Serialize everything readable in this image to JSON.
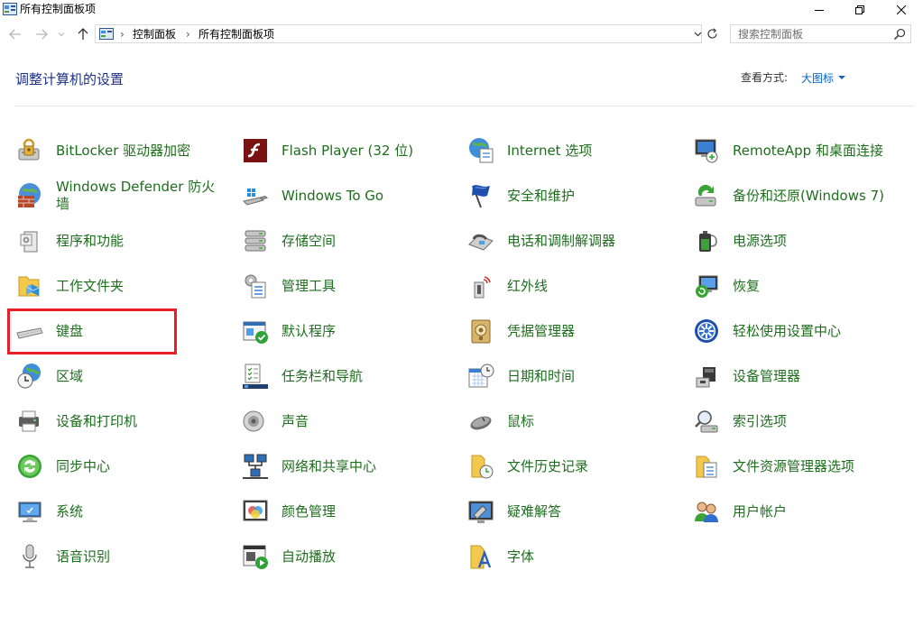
{
  "window": {
    "title": "所有控制面板项"
  },
  "address": {
    "crumbs": [
      "控制面板",
      "所有控制面板项"
    ]
  },
  "search": {
    "placeholder": "搜索控制面板"
  },
  "header": {
    "heading": "调整计算机的设置",
    "viewby_label": "查看方式:",
    "viewby_value": "大图标"
  },
  "accent": {
    "link_green": "#1e6e1e",
    "heading_blue": "#1e3287",
    "highlight_red": "#e81f27"
  },
  "columns": [
    [
      {
        "label": "BitLocker 驱动器加密",
        "icon": "bitlocker-icon"
      },
      {
        "label": "Windows Defender 防火墙",
        "icon": "firewall-icon"
      },
      {
        "label": "程序和功能",
        "icon": "programs-icon"
      },
      {
        "label": "工作文件夹",
        "icon": "work-folders-icon"
      },
      {
        "label": "键盘",
        "icon": "keyboard-icon"
      },
      {
        "label": "区域",
        "icon": "region-icon"
      },
      {
        "label": "设备和打印机",
        "icon": "printer-icon"
      },
      {
        "label": "同步中心",
        "icon": "sync-icon"
      },
      {
        "label": "系统",
        "icon": "system-icon"
      },
      {
        "label": "语音识别",
        "icon": "microphone-icon"
      }
    ],
    [
      {
        "label": "Flash Player (32 位)",
        "icon": "flash-icon"
      },
      {
        "label": "Windows To Go",
        "icon": "usb-drive-icon"
      },
      {
        "label": "存储空间",
        "icon": "storage-icon"
      },
      {
        "label": "管理工具",
        "icon": "admin-tools-icon"
      },
      {
        "label": "默认程序",
        "icon": "default-programs-icon"
      },
      {
        "label": "任务栏和导航",
        "icon": "taskbar-icon"
      },
      {
        "label": "声音",
        "icon": "speaker-icon"
      },
      {
        "label": "网络和共享中心",
        "icon": "network-icon"
      },
      {
        "label": "颜色管理",
        "icon": "color-icon"
      },
      {
        "label": "自动播放",
        "icon": "autoplay-icon"
      }
    ],
    [
      {
        "label": "Internet 选项",
        "icon": "internet-icon"
      },
      {
        "label": "安全和维护",
        "icon": "flag-icon"
      },
      {
        "label": "电话和调制解调器",
        "icon": "phone-icon"
      },
      {
        "label": "红外线",
        "icon": "infrared-icon"
      },
      {
        "label": "凭据管理器",
        "icon": "credential-icon"
      },
      {
        "label": "日期和时间",
        "icon": "datetime-icon"
      },
      {
        "label": "鼠标",
        "icon": "mouse-icon"
      },
      {
        "label": "文件历史记录",
        "icon": "file-history-icon"
      },
      {
        "label": "疑难解答",
        "icon": "troubleshoot-icon"
      },
      {
        "label": "字体",
        "icon": "font-icon"
      }
    ],
    [
      {
        "label": "RemoteApp 和桌面连接",
        "icon": "remote-icon"
      },
      {
        "label": "备份和还原(Windows 7)",
        "icon": "backup-icon"
      },
      {
        "label": "电源选项",
        "icon": "power-icon"
      },
      {
        "label": "恢复",
        "icon": "recovery-icon"
      },
      {
        "label": "轻松使用设置中心",
        "icon": "ease-of-access-icon"
      },
      {
        "label": "设备管理器",
        "icon": "device-manager-icon"
      },
      {
        "label": "索引选项",
        "icon": "indexing-icon"
      },
      {
        "label": "文件资源管理器选项",
        "icon": "folder-options-icon"
      },
      {
        "label": "用户帐户",
        "icon": "user-accounts-icon"
      }
    ]
  ]
}
